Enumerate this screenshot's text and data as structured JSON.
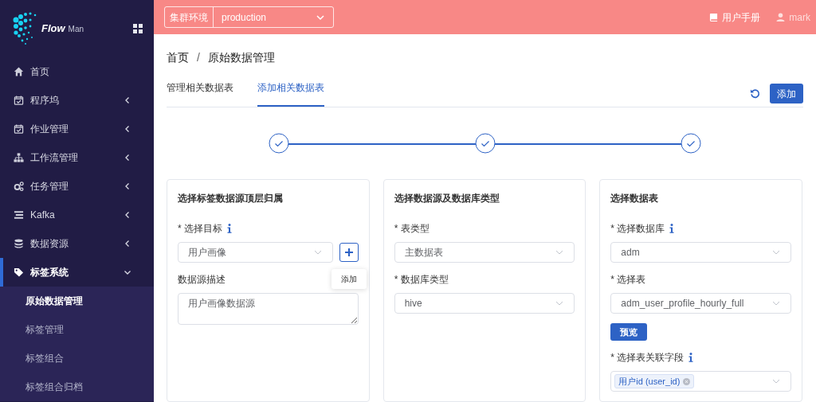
{
  "sidebar": {
    "logo": {
      "word": "Flow",
      "suffix": "Man"
    },
    "items": [
      {
        "label": "首页",
        "kind": "link",
        "expanded": false
      },
      {
        "label": "程序坞",
        "kind": "group",
        "expanded": false
      },
      {
        "label": "作业管理",
        "kind": "group",
        "expanded": false
      },
      {
        "label": "工作流管理",
        "kind": "group",
        "expanded": false
      },
      {
        "label": "任务管理",
        "kind": "group",
        "expanded": false
      },
      {
        "label": "Kafka",
        "kind": "group",
        "expanded": false
      },
      {
        "label": "数据资源",
        "kind": "group",
        "expanded": false
      },
      {
        "label": "标签系统",
        "kind": "group",
        "expanded": true,
        "children": [
          {
            "label": "原始数据管理",
            "selected": true
          },
          {
            "label": "标签管理",
            "selected": false
          },
          {
            "label": "标签组合",
            "selected": false
          },
          {
            "label": "标签组合归档",
            "selected": false
          }
        ]
      }
    ]
  },
  "header": {
    "cluster_label": "集群环境",
    "cluster_value": "production",
    "manual": "用户手册",
    "user": "mark"
  },
  "breadcrumb": {
    "items": [
      "首页",
      "原始数据管理"
    ],
    "separator": "/"
  },
  "tabs": [
    {
      "label": "管理相关数据表",
      "selected": false
    },
    {
      "label": "添加相关数据表",
      "selected": true
    }
  ],
  "add_button": "添加",
  "steps": [
    {
      "completed": true
    },
    {
      "completed": true
    },
    {
      "completed": true
    }
  ],
  "cards": [
    {
      "title": "选择标签数据源顶层归属",
      "fields": [
        {
          "kind": "select",
          "label": "* 选择目标",
          "info": true,
          "value": "用户画像",
          "add_button": true,
          "tooltip": "添加"
        },
        {
          "kind": "textarea",
          "label": "数据源描述",
          "info": false,
          "value": "用户画像数据源"
        }
      ]
    },
    {
      "title": "选择数据源及数据库类型",
      "fields": [
        {
          "kind": "select",
          "label": "* 表类型",
          "info": false,
          "value": "主数据表"
        },
        {
          "kind": "select",
          "label": "* 数据库类型",
          "info": false,
          "value": "hive"
        }
      ]
    },
    {
      "title": "选择数据表",
      "fields": [
        {
          "kind": "select",
          "label": "* 选择数据库",
          "info": true,
          "value": "adm"
        },
        {
          "kind": "select",
          "label": "* 选择表",
          "info": false,
          "value": "adm_user_profile_hourly_full"
        },
        {
          "kind": "button",
          "value": "预览"
        },
        {
          "kind": "tags",
          "label": "* 选择表关联字段",
          "info": true,
          "tags": [
            "用户id (user_id)"
          ]
        }
      ]
    }
  ]
}
